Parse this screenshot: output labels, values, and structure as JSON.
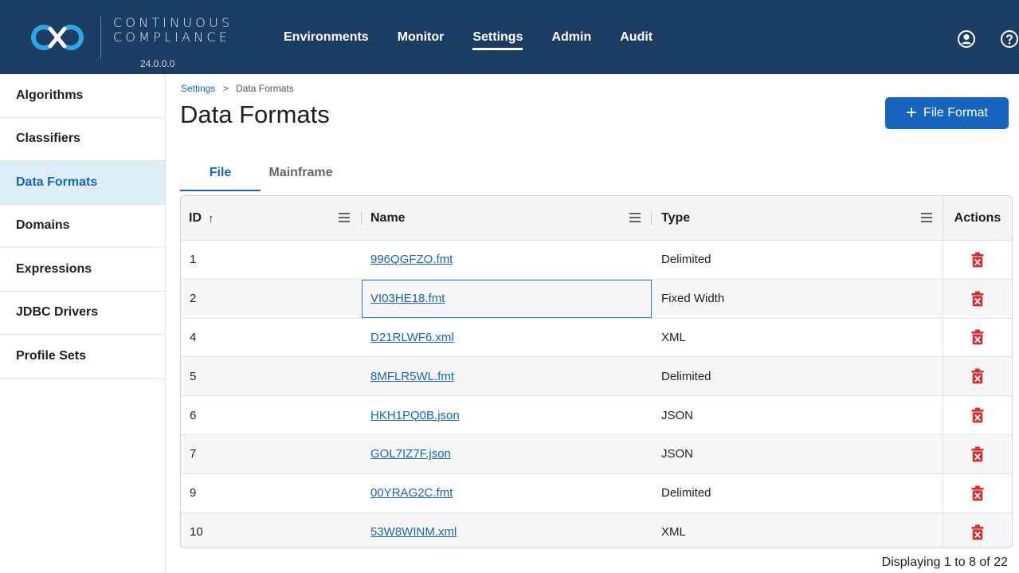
{
  "brand": {
    "line1": "CONTINUOUS",
    "line2": "COMPLIANCE",
    "version": "24.0.0.0"
  },
  "nav": [
    "Environments",
    "Monitor",
    "Settings",
    "Admin",
    "Audit"
  ],
  "nav_active": "Settings",
  "sidebar": {
    "items": [
      {
        "label": "Algorithms"
      },
      {
        "label": "Classifiers"
      },
      {
        "label": "Data Formats"
      },
      {
        "label": "Domains"
      },
      {
        "label": "Expressions"
      },
      {
        "label": "JDBC Drivers"
      },
      {
        "label": "Profile Sets"
      }
    ],
    "active": "Data Formats"
  },
  "breadcrumb": {
    "parent": "Settings",
    "separator": ">",
    "current": "Data Formats"
  },
  "page_title": "Data Formats",
  "add_button": {
    "plus": "+",
    "label": "File Format"
  },
  "tabs": [
    {
      "label": "File"
    },
    {
      "label": "Mainframe"
    }
  ],
  "tab_active": "File",
  "table": {
    "columns": {
      "id": "ID",
      "sort_arrow": "↑",
      "name": "Name",
      "type": "Type",
      "actions": "Actions"
    },
    "rows": [
      {
        "id": "1",
        "name": "996QGFZO.fmt",
        "type": "Delimited"
      },
      {
        "id": "2",
        "name": "VI03HE18.fmt",
        "type": "Fixed Width"
      },
      {
        "id": "4",
        "name": "D21RLWF6.xml",
        "type": "XML"
      },
      {
        "id": "5",
        "name": "8MFLR5WL.fmt",
        "type": "Delimited"
      },
      {
        "id": "6",
        "name": "HKH1PQ0B.json",
        "type": "JSON"
      },
      {
        "id": "7",
        "name": "GOL7IZ7F.json",
        "type": "JSON"
      },
      {
        "id": "9",
        "name": "00YRAG2C.fmt",
        "type": "Delimited"
      },
      {
        "id": "10",
        "name": "53W8WINM.xml",
        "type": "XML"
      }
    ]
  },
  "status": "Displaying 1 to 8 of 22",
  "colors": {
    "topbar": "#1b3d63",
    "accent": "#1565c0",
    "delete": "#d32f2f",
    "sidebar_active": "#ddeef8"
  },
  "icons": {
    "logo": "continuous-compliance-logo",
    "account": "user-circle-icon",
    "help": "help-circle-icon",
    "column_menu": "hamburger-menu-icon",
    "delete": "trash-icon"
  }
}
